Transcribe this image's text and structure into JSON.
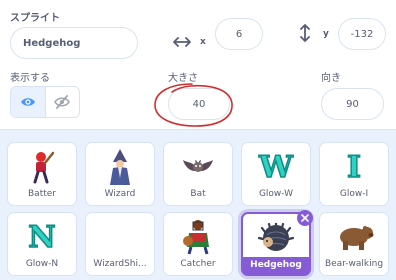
{
  "sprite_info": {
    "sprite_label": "スプライト",
    "sprite_name": "Hedgehog",
    "x_label": "x",
    "x_value": "6",
    "y_label": "y",
    "y_value": "-132",
    "show_label": "表示する",
    "size_label": "大きさ",
    "size_value": "40",
    "direction_label": "向き",
    "direction_value": "90",
    "annotation_color": "#d12e2e"
  },
  "sprites": [
    {
      "name": "Batter",
      "icon": "batter-icon"
    },
    {
      "name": "Wizard",
      "icon": "wizard-icon"
    },
    {
      "name": "Bat",
      "icon": "bat-icon"
    },
    {
      "name": "Glow-W",
      "icon": "glow-w-icon",
      "glyph": "W"
    },
    {
      "name": "Glow-I",
      "icon": "glow-i-icon",
      "glyph": "I"
    },
    {
      "name": "Glow-N",
      "icon": "glow-n-icon",
      "glyph": "N"
    },
    {
      "name": "WizardShi...",
      "icon": "wizard-shirt-icon"
    },
    {
      "name": "Catcher",
      "icon": "catcher-icon"
    },
    {
      "name": "Hedgehog",
      "icon": "hedgehog-icon",
      "selected": true
    },
    {
      "name": "Bear-walking",
      "icon": "bear-walking-icon"
    }
  ],
  "colors": {
    "accent": "#855cd6",
    "panel_bg": "#e9f1fc",
    "selected": "#855cd6",
    "text": "#575e75"
  }
}
